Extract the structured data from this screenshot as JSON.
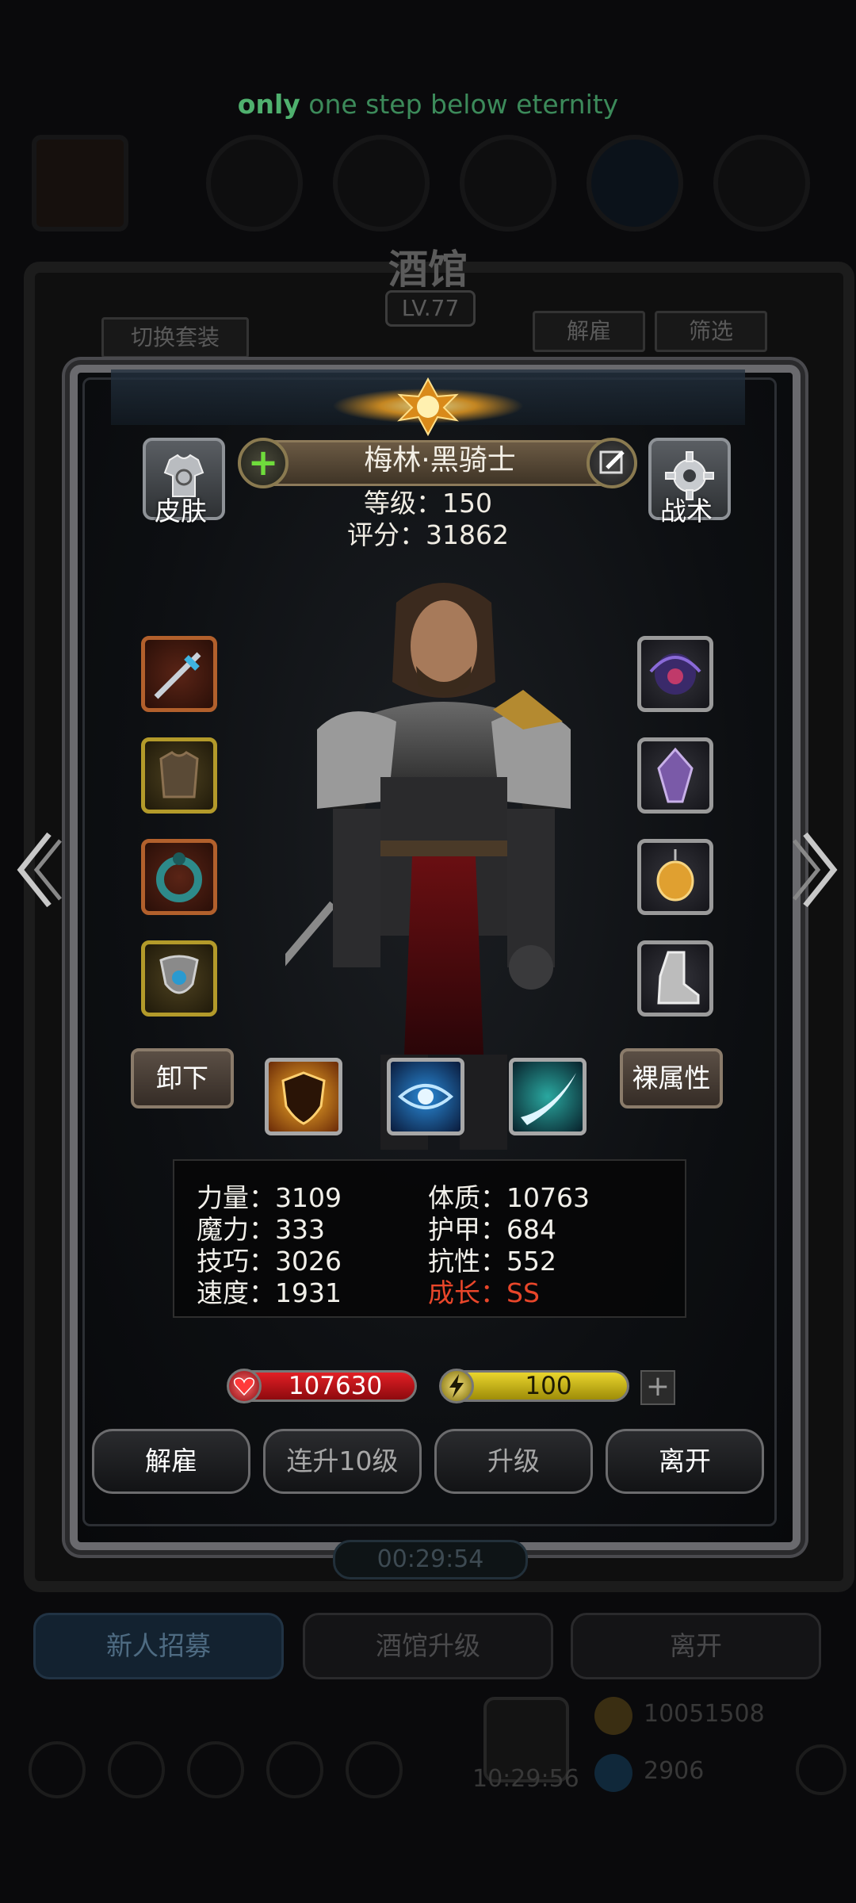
{
  "caption": {
    "first": "only",
    "rest": " one step below eternity"
  },
  "background": {
    "title": "酒馆",
    "level": "LV.77",
    "switch_outfit": "切换套装",
    "dismiss": "解雇",
    "filter": "筛选",
    "timer": "00:29:54",
    "buttons": {
      "recruit": "新人招募",
      "upgrade": "酒馆升级",
      "leave": "离开"
    },
    "gift_timer": "10:29:56",
    "gold": "10051508",
    "gems": "2906"
  },
  "hero": {
    "name": "梅林·黑骑士",
    "level_line": "等级：150",
    "score_line": "评分：31862",
    "skin_label": "皮肤",
    "tactics_label": "战术",
    "unequip_label": "卸下",
    "base_attr_label": "裸属性"
  },
  "attributes": {
    "strength": "力量：3109",
    "magic": "魔力：333",
    "skill": "技巧：3026",
    "speed": "速度：1931",
    "constitution": "体质：10763",
    "armor": "护甲：684",
    "resistance": "抗性：552",
    "growth": "成长：SS"
  },
  "bars": {
    "hp": "107630",
    "energy": "100",
    "add": "+"
  },
  "actions": {
    "dismiss": "解雇",
    "level10": "连升10级",
    "upgrade": "升级",
    "leave": "离开"
  },
  "icons": {
    "left_slots": [
      "sword-icon",
      "armor-icon",
      "ring-icon",
      "amulet-icon"
    ],
    "right_slots": [
      "dark-orb-icon",
      "crystal-icon",
      "lantern-icon",
      "boot-icon"
    ],
    "skills": [
      "fire-shield-icon",
      "eye-icon",
      "slash-icon"
    ]
  },
  "colors": {
    "growth": "#e8462a",
    "hp": "#e21f25",
    "energy": "#e9d52d",
    "plus": "#6fdc3c"
  }
}
